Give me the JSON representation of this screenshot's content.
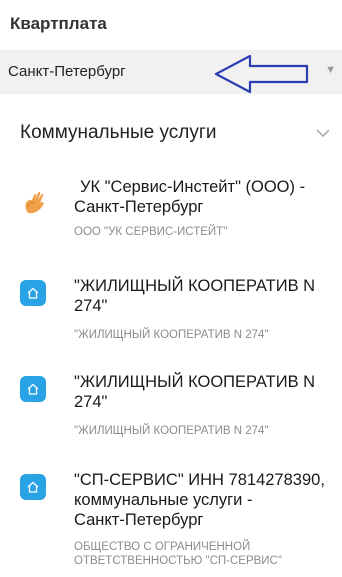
{
  "header": {
    "title": "Квартплата"
  },
  "region": {
    "city": "Санкт-Петербург",
    "chevron": "chevron-down-icon"
  },
  "section": {
    "title": "Коммунальные услуги",
    "chevron": "chevron-down-icon"
  },
  "accent_color": "#2aa3e6",
  "arrow_color": "#2b3fb3",
  "items": [
    {
      "title_line1": "УК \"Сервис-Инстейт\" (ООО) -",
      "title_line2": "Санкт-Петербург",
      "title_line3": "",
      "subtitle_line1": "ООО \"УК СЕРВИС-ИСТЕЙТ\"",
      "subtitle_line2": "",
      "icon": "hand-logo-icon"
    },
    {
      "title_line1": "\"ЖИЛИЩНЫЙ КООПЕРАТИВ N",
      "title_line2": "274\"",
      "title_line3": "",
      "subtitle_line1": "\"ЖИЛИЩНЫЙ КООПЕРАТИВ N 274\"",
      "subtitle_line2": "",
      "icon": "house-icon"
    },
    {
      "title_line1": "\"ЖИЛИЩНЫЙ КООПЕРАТИВ N",
      "title_line2": "274\"",
      "title_line3": "",
      "subtitle_line1": "\"ЖИЛИЩНЫЙ КООПЕРАТИВ N 274\"",
      "subtitle_line2": "",
      "icon": "house-icon"
    },
    {
      "title_line1": "\"СП-СЕРВИС\" ИНН 7814278390,",
      "title_line2": "коммунальные услуги -",
      "title_line3": "Санкт-Петербург",
      "subtitle_line1": "ОБЩЕСТВО С ОГРАНИЧЕННОЙ",
      "subtitle_line2": "ОТВЕТСТВЕННОСТЬЮ \"СП-СЕРВИС\"",
      "icon": "house-icon"
    }
  ]
}
